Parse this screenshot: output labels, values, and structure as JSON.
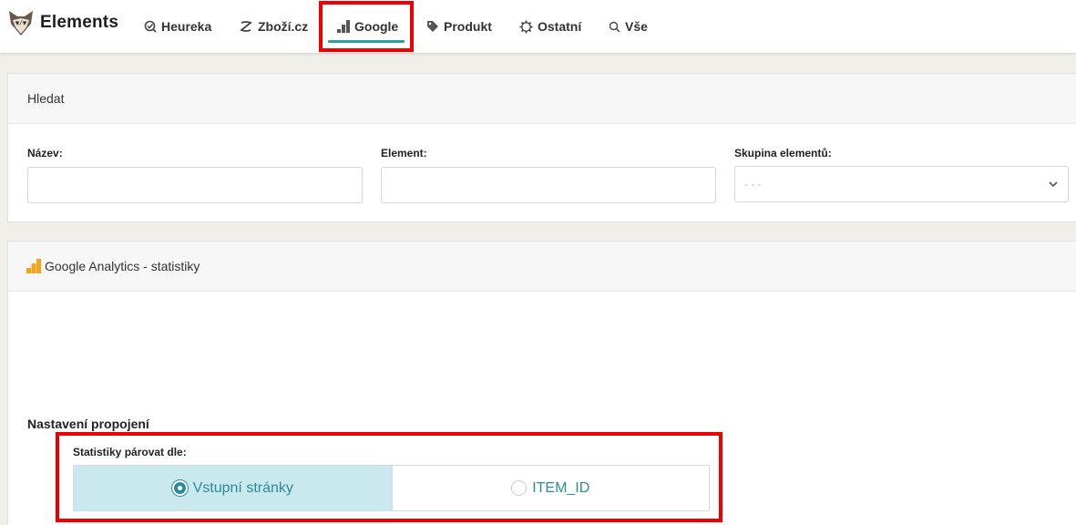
{
  "app": {
    "name": "Elements"
  },
  "nav": {
    "items": [
      {
        "label": "Heureka",
        "icon": "heureka-icon"
      },
      {
        "label": "Zboží.cz",
        "icon": "zbozi-icon"
      },
      {
        "label": "Google",
        "icon": "google-bars-icon",
        "active": true
      },
      {
        "label": "Produkt",
        "icon": "tag-icon"
      },
      {
        "label": "Ostatní",
        "icon": "gear-icon"
      },
      {
        "label": "Vše",
        "icon": "search-icon"
      }
    ]
  },
  "search_panel": {
    "title": "Hledat",
    "fields": {
      "name": {
        "label": "Název:",
        "value": ""
      },
      "element": {
        "label": "Element:",
        "value": ""
      },
      "group": {
        "label": "Skupina elementů:",
        "selected": "- - -"
      }
    }
  },
  "analytics_panel": {
    "title": "Google Analytics - statistiky",
    "connection_title": "Nastavení propojení",
    "pair_label": "Statistiky párovat dle:",
    "options": [
      {
        "label": "Vstupní stránky",
        "selected": true
      },
      {
        "label": "ITEM_ID",
        "selected": false
      }
    ]
  },
  "colors": {
    "accent": "#2aa0a4",
    "highlight_box": "#ee0000",
    "selected_bg": "#c9e9ee",
    "google_orange": "#f4a51d"
  }
}
